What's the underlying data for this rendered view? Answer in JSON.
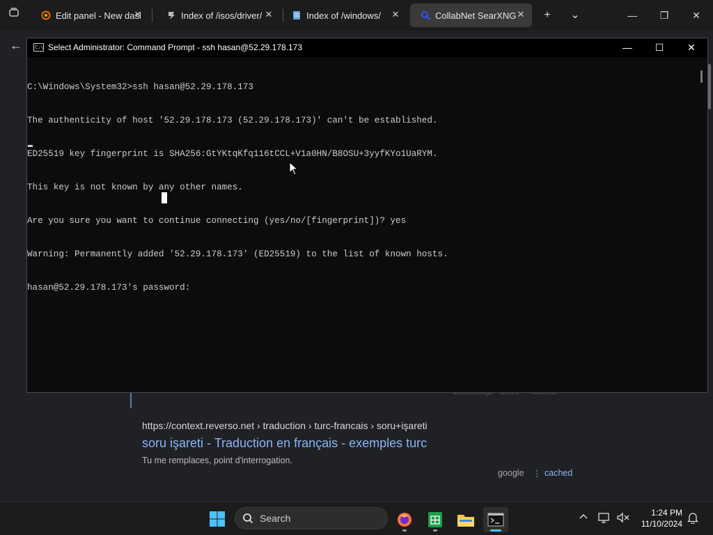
{
  "browser": {
    "tabs": [
      {
        "label": "Edit panel - New dashb",
        "favicon": "grafana-icon",
        "active": false
      },
      {
        "label": "Index of /isos/driver/",
        "favicon": "folder-stack-icon",
        "active": false
      },
      {
        "label": "Index of /windows/",
        "favicon": "document-icon",
        "active": false
      },
      {
        "label": "CollabNet SearXNG",
        "favicon": "searxng-icon",
        "active": true
      }
    ],
    "close_glyph": "✕",
    "new_tab_glyph": "+",
    "tab_list_glyph": "⌄",
    "back_glyph": "←",
    "window_controls": {
      "minimize": "—",
      "restore": "❐",
      "close": "✕"
    }
  },
  "search_result": {
    "url": "https://context.reverso.net  › traduction › turc-francais › soru+işareti",
    "title": "soru işareti - Traduction en français - exemples turc",
    "description": "Tu me remplaces, point d'interrogation.",
    "engine": "google",
    "separator": "⋮",
    "cached_label": "cached",
    "prev_result_meta": "duckduckgo · brave   ⋮   cached"
  },
  "cmd": {
    "title": "Select Administrator: Command Prompt - ssh  hasan@52.29.178.173",
    "controls": {
      "minimize": "—",
      "maximize": "☐",
      "close": "✕"
    },
    "lines": [
      "C:\\Windows\\System32>ssh hasan@52.29.178.173",
      "The authenticity of host '52.29.178.173 (52.29.178.173)' can't be established.",
      "ED25519 key fingerprint is SHA256:GtYKtqKfq116tCCL+V1a0HN/B8OSU+3yyfKYo1UaRYM.",
      "This key is not known by any other names.",
      "Are you sure you want to continue connecting (yes/no/[fingerprint])? yes",
      "Warning: Permanently added '52.29.178.173' (ED25519) to the list of known hosts.",
      "hasan@52.29.178.173's password:"
    ]
  },
  "taskbar": {
    "search_label": "Search",
    "apps": [
      "firefox-icon",
      "spreadsheet-icon",
      "file-explorer-icon",
      "terminal-icon"
    ],
    "tray_chevron": "^",
    "clock_time": "1:24 PM",
    "clock_date": "11/10/2024"
  },
  "colors": {
    "accent_link": "#8ab4f8",
    "console_bg": "#0c0c0c",
    "console_text": "#cccccc",
    "taskbar_bg": "#1c1c1c"
  }
}
